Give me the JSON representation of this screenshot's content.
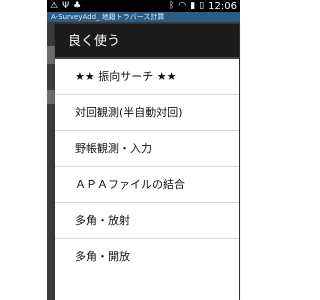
{
  "status_bar": {
    "time": "12:06",
    "icons": [
      "warning-icon",
      "usb-icon",
      "android-debug-icon",
      "bluetooth-icon",
      "wifi-icon",
      "signal-icon",
      "battery-icon"
    ]
  },
  "app_bar": {
    "title": "A-SurveyAdd_  地籍トラバース計算"
  },
  "dialog": {
    "title": "良く使う",
    "items": [
      "★★ 振向サーチ ★★",
      "対回観測(半自動対回)",
      "野帳観測・入力",
      "ＡＰＡファイルの結合",
      "多角・放射",
      "多角・開放"
    ]
  }
}
